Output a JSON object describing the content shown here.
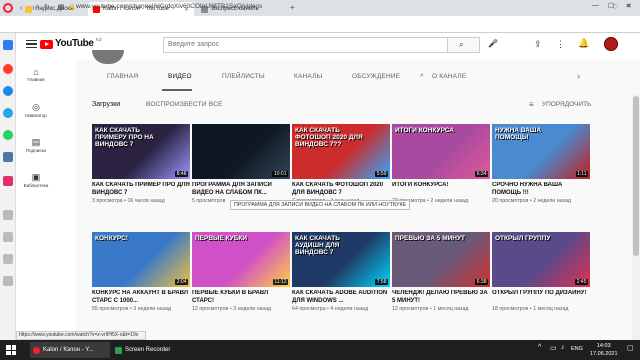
{
  "browser": {
    "tabs": [
      {
        "label": "Яндекс.Диск",
        "color": "#f7c23b"
      },
      {
        "label": "Kalon / Кэлон - YouTube",
        "color": "#ff0000"
      },
      {
        "label": "Экспресс-панель",
        "color": "#8a8a8a"
      }
    ],
    "url": "www.youtube.com/channel/UCrdqXlv60COInUIj8TB1SaQ/videos",
    "status_url": "https://www.youtube.com/watch?v=z-vrIIH5X-o&t=19s"
  },
  "youtube": {
    "logo_text": "YouTube",
    "logo_suffix": "KZ",
    "search_placeholder": "Введите запрос",
    "nav": [
      {
        "label": "Главная",
        "icon": "home-icon"
      },
      {
        "label": "Навигатор",
        "icon": "compass-icon"
      },
      {
        "label": "Подписки",
        "icon": "subscriptions-icon"
      },
      {
        "label": "Библиотека",
        "icon": "library-icon"
      }
    ],
    "channel_tabs": [
      "ГЛАВНАЯ",
      "ВИДЕО",
      "ПЛЕЙЛИСТЫ",
      "КАНАЛЫ",
      "ОБСУЖДЕНИЕ",
      "О КАНАЛЕ"
    ],
    "active_tab": "ВИДЕО",
    "uploads_label": "Загрузки",
    "play_all_label": "ВОСПРОИЗВЕСТИ ВСЕ",
    "sort_label": "УПОРЯДОЧИТЬ",
    "tooltip": "ПРОГРАММА ДЛЯ ЗАПИСИ ВИДЕО НА СЛАБОМ ПК ИЛИ НОУТБУКЕ"
  },
  "videos": [
    {
      "title": "КАК СКАЧАТЬ ПРИМЕР ПРО ДЛЯ ВИНДОВС 7",
      "views": "3 просмотра",
      "age": "16 часов назад",
      "duration": "8:48",
      "thumb_text": "КАК СКАЧАТЬ ПРИМЕРУ ПРО НА ВИНДОВС 7",
      "bg": "#2a2240",
      "accent": "#9999ff"
    },
    {
      "title": "ПРОГРАММА ДЛЯ ЗАПИСИ ВИДЕО НА СЛАБОМ ПК...",
      "views": "5 просмотров",
      "age": "",
      "duration": "10:01",
      "thumb_text": "",
      "bg": "#0e1822",
      "accent": "#334455"
    },
    {
      "title": "КАК СКАЧАТЬ ФОТОШОП 2020 ДЛЯ ВИНДОВС 7",
      "views": "7 просмотров",
      "age": "4 дня назад",
      "duration": "5:59",
      "thumb_text": "КАК СКАЧАТЬ ФОТОШОП 2020 ДЛЯ ВИНДОВС 7??",
      "bg": "#cc2c2c",
      "accent": "#31a8ff"
    },
    {
      "title": "ИТОГИ КОНКУРСА!",
      "views": "23 просмотра",
      "age": "2 недели назад",
      "duration": "6:34",
      "thumb_text": "ИТОГИ КОНКУРСА",
      "bg": "#a84aa0",
      "accent": "#e05a9a"
    },
    {
      "title": "СРОЧНО НУЖНА ВАША ПОМОЩЬ !!!",
      "views": "20 просмотров",
      "age": "2 недели назад",
      "duration": "1:11",
      "thumb_text": "НУЖНА ВАША ПОМОЩЬ!",
      "bg": "#4a8ad0",
      "accent": "#c02020"
    },
    {
      "title": "КОНКУРС НА АККАУНТ В БРАВЛ СТАРС С 1000...",
      "views": "55 просмотров",
      "age": "3 недели назад",
      "duration": "2:04",
      "thumb_text": "КОНКУРС!",
      "bg": "#3a78c8",
      "accent": "#f0c040"
    },
    {
      "title": "ПЕРВЫЕ КУБКИ В БРАВЛ СТАРС!",
      "views": "12 просмотров",
      "age": "3 недели назад",
      "duration": "11:12",
      "thumb_text": "ПЕРВЫЕ КУБКИ",
      "bg": "#d050c8",
      "accent": "#ffd040"
    },
    {
      "title": "КАК СКАЧАТЬ ADOBE AUDITION ДЛЯ WINDOWS ...",
      "views": "64 просмотра",
      "age": "4 недели назад",
      "duration": "7:58",
      "thumb_text": "КАК СКАЧАТЬ АУДИШН ДЛЯ ВИНДОВС 7",
      "bg": "#1f3a66",
      "accent": "#00d4ff"
    },
    {
      "title": "ЧЕЛЕНДЖ! ДЕЛАЮ ПРЕВЬЮ ЗА 5 МИНУТ!",
      "views": "12 просмотров",
      "age": "1 месяц назад",
      "duration": "6:38",
      "thumb_text": "ПРЕВЬЮ ЗА 5 МИНУТ",
      "bg": "#6a5a7a",
      "accent": "#d03030"
    },
    {
      "title": "ОТКРЫЛ ГРУППУ ПО ДИЗАЙНУ!",
      "views": "18 просмотров",
      "age": "1 месяц назад",
      "duration": "2:45",
      "thumb_text": "ОТКРЫЛ ГРУППУ",
      "bg": "#5a4a8a",
      "accent": "#e03050"
    }
  ],
  "taskbar": {
    "items": [
      {
        "label": "Kalon / Кэлон - Y...",
        "color": "#ff1b2d"
      },
      {
        "label": "Screen Recorder",
        "color": "#2aa04a"
      }
    ],
    "lang": "ENG",
    "time": "14:03",
    "date": "17.06.2021"
  }
}
